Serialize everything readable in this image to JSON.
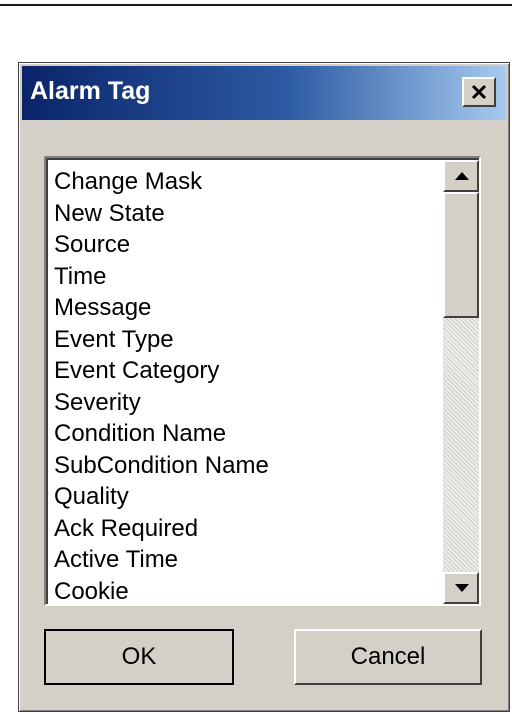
{
  "window": {
    "title": "Alarm Tag",
    "close_icon": "close-x-icon"
  },
  "list": {
    "items": [
      "Change Mask",
      "New State",
      "Source",
      "Time",
      "Message",
      "Event Type",
      "Event Category",
      "Severity",
      "Condition Name",
      "SubCondition Name",
      "Quality",
      "Ack Required",
      "Active Time",
      "Cookie"
    ],
    "scroll_up_icon": "arrow-up-icon",
    "scroll_down_icon": "arrow-down-icon"
  },
  "buttons": {
    "ok_label": "OK",
    "cancel_label": "Cancel"
  },
  "colors": {
    "titlebar_start": "#0a246a",
    "titlebar_end": "#a6caf0",
    "dialog_face": "#d4d0c8"
  }
}
